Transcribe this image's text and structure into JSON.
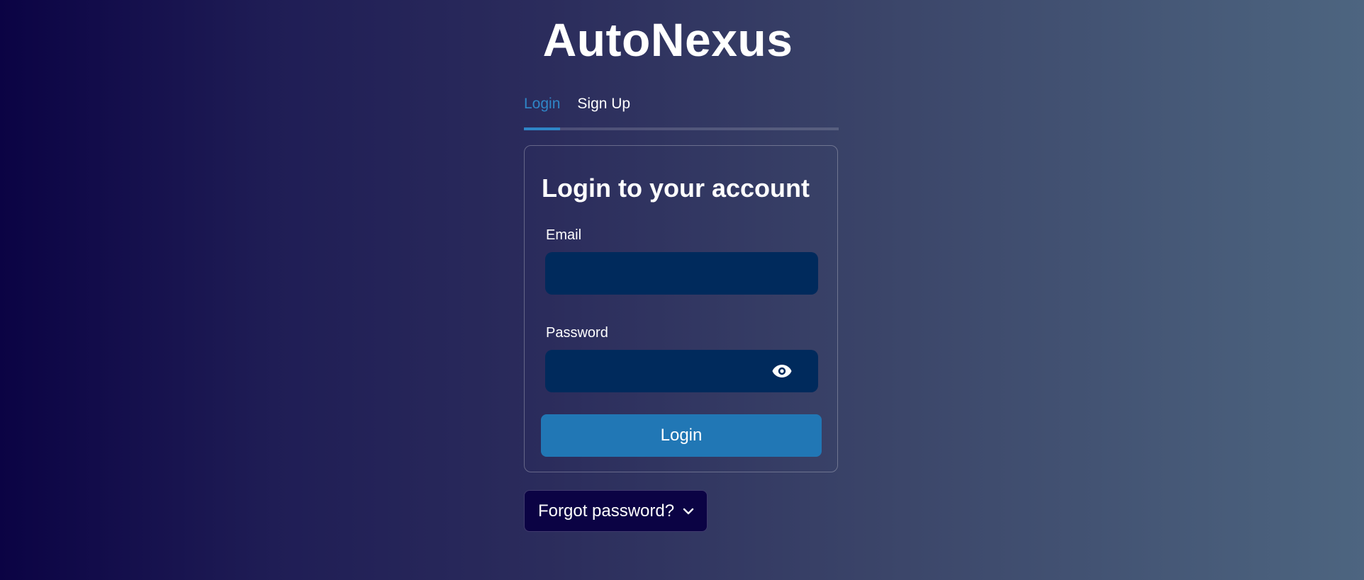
{
  "app": {
    "title": "AutoNexus"
  },
  "tabs": [
    {
      "label": "Login",
      "active": true
    },
    {
      "label": "Sign Up",
      "active": false
    }
  ],
  "login_card": {
    "heading": "Login to your account",
    "email": {
      "label": "Email",
      "value": "",
      "placeholder": ""
    },
    "password": {
      "label": "Password",
      "value": "",
      "placeholder": "",
      "toggle_icon": "eye-icon"
    },
    "submit_label": "Login"
  },
  "forgot_password": {
    "label": "Forgot password?",
    "icon": "chevron-down-icon"
  },
  "colors": {
    "accent": "#2f86c7",
    "button": "#2177b5",
    "input_bg": "#002a5c",
    "gradient_start": "#0b0344",
    "gradient_end": "#4d6580"
  }
}
